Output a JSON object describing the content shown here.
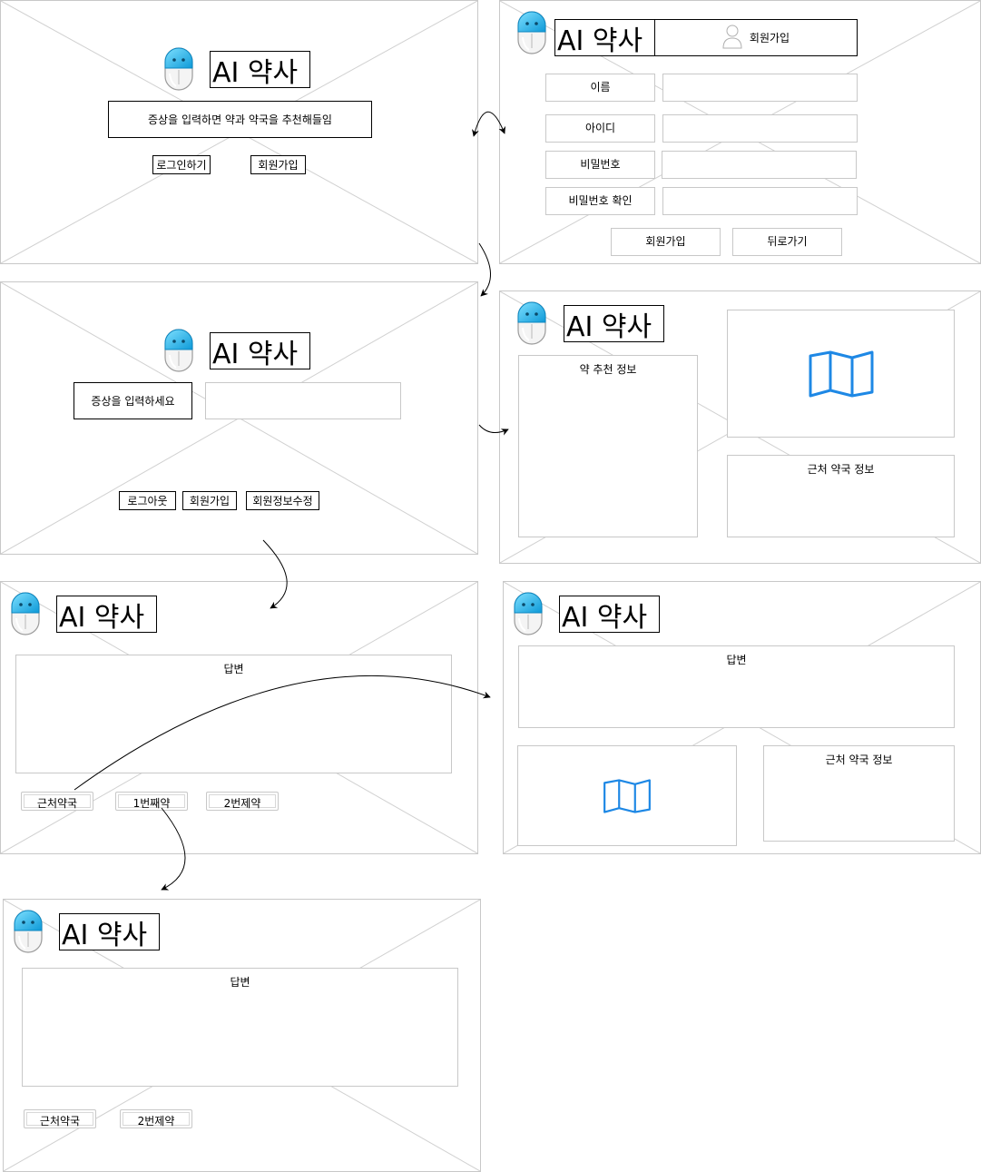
{
  "app_title": "AI 약사",
  "screen_home": {
    "tagline": "증상을 입력하면 약과 약국을 추천해들임",
    "login_label": "로그인하기",
    "signup_label": "회원가입"
  },
  "screen_signup": {
    "header_label": "회원가입",
    "fields": [
      {
        "label": "이름"
      },
      {
        "label": "아이디"
      },
      {
        "label": "비밀번호"
      },
      {
        "label": "비밀번호 확인"
      }
    ],
    "submit_label": "회원가입",
    "back_label": "뒤로가기"
  },
  "screen_main": {
    "symptom_label": "증상을 입력하세요",
    "logout_label": "로그아웃",
    "signup_label": "회원가입",
    "edit_profile_label": "회원정보수정"
  },
  "screen_results": {
    "drug_info_label": "약 추천 정보",
    "pharmacy_info_label": "근처 약국 정보"
  },
  "screen_answer": {
    "answer_label": "답변",
    "nearby_label": "근처약국",
    "drug1_label": "1번째약",
    "drug2_label": "2번제약"
  },
  "screen_nearby": {
    "answer_label": "답변",
    "pharmacy_info_label": "근처 약국 정보"
  },
  "screen_drug1": {
    "answer_label": "답변",
    "nearby_label": "근처약국",
    "drug2_label": "2번제약"
  },
  "icons": {
    "logo": "pill-robot-icon",
    "map": "map-icon",
    "user": "user-icon"
  },
  "colors": {
    "pill_blue": "#22b8f0",
    "map_blue": "#1e88e5",
    "wire_gray": "#c8c8c8"
  }
}
